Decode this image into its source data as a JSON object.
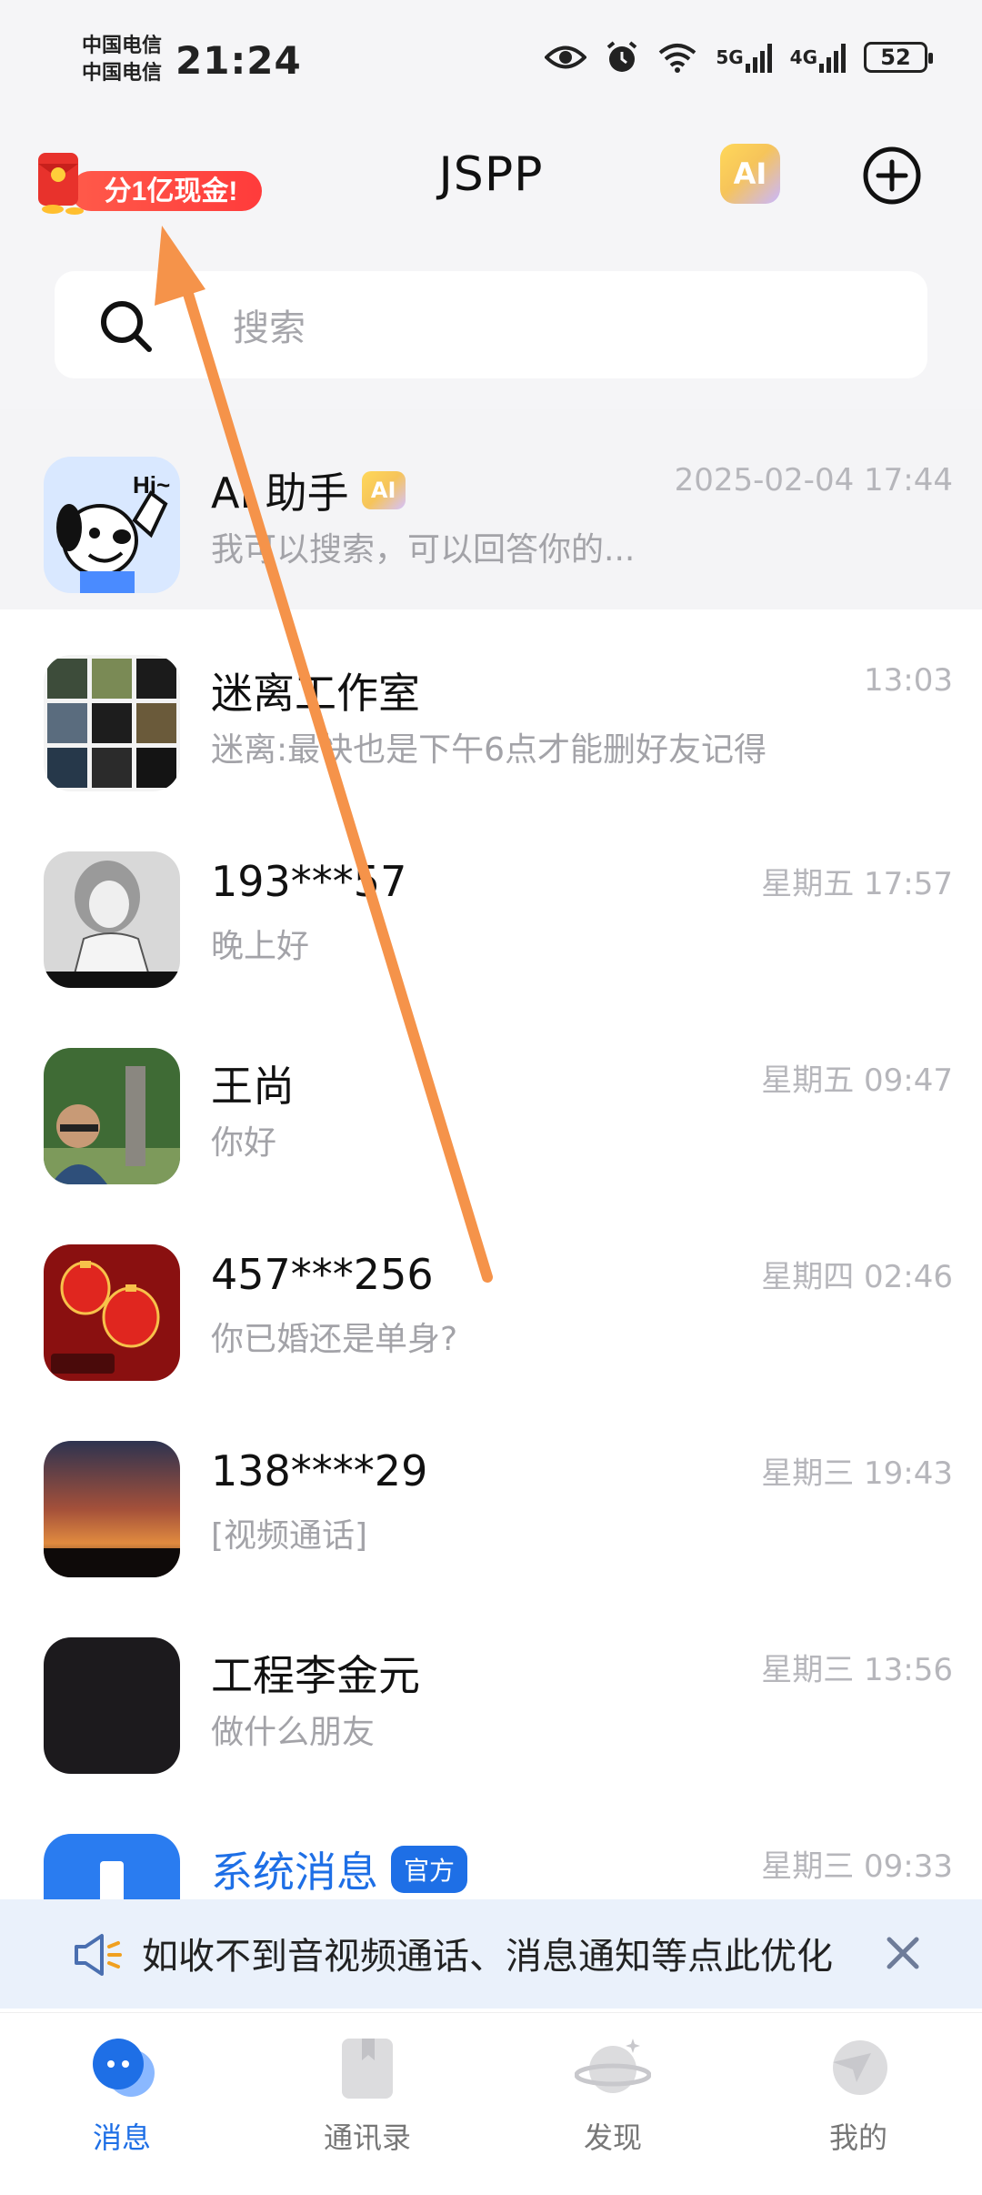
{
  "status_bar": {
    "carrier_1": "中国电信",
    "carrier_2": "中国电信",
    "time": "21:24",
    "network_5g": "5G",
    "network_4g": "4G",
    "battery": "52"
  },
  "header": {
    "title": "JSPP",
    "promo_text": "分1亿现金!",
    "ai_label": "AI"
  },
  "search": {
    "placeholder": "搜索"
  },
  "conversations": [
    {
      "name": "AI 助手",
      "badge": "AI",
      "preview": "我可以搜索，可以回答你的...",
      "time": "2025-02-04 17:44",
      "pinned": true
    },
    {
      "name": "迷离工作室",
      "preview": "迷离:最快也是下午6点才能删好友记得",
      "time": "13:03"
    },
    {
      "name": "193***57",
      "preview": "晚上好",
      "time": "星期五 17:57"
    },
    {
      "name": "王尚",
      "preview": "你好",
      "time": "星期五 09:47"
    },
    {
      "name": "457***256",
      "preview": "你已婚还是单身?",
      "time": "星期四 02:46"
    },
    {
      "name": "138****29",
      "preview": "[视频通话]",
      "time": "星期三 19:43"
    },
    {
      "name": "工程李金元",
      "preview": "做什么朋友",
      "time": "星期三 13:56"
    },
    {
      "name": "系统消息",
      "badge": "官方",
      "preview": "",
      "time": "星期三 09:33"
    }
  ],
  "banner": {
    "text": "如收不到音视频通话、消息通知等点此优化"
  },
  "tabs": [
    {
      "label": "消息",
      "active": true
    },
    {
      "label": "通讯录"
    },
    {
      "label": "发现"
    },
    {
      "label": "我的"
    }
  ],
  "colors": {
    "accent": "#1e6fe6",
    "background": "#f5f5f7",
    "annotation_arrow": "#f5934a"
  }
}
